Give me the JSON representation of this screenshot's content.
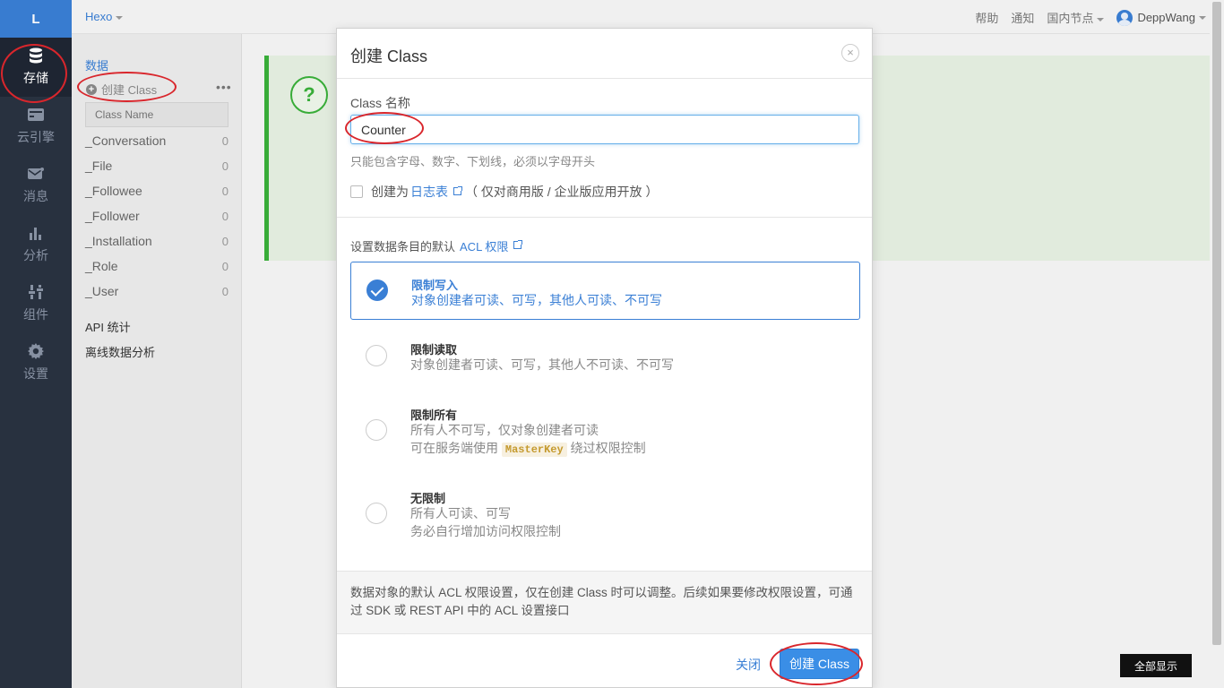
{
  "leftnav": {
    "logo": "L",
    "items": [
      {
        "label": "存储",
        "icon": "database-icon",
        "active": true
      },
      {
        "label": "云引擎",
        "icon": "server-icon"
      },
      {
        "label": "消息",
        "icon": "envelope-icon"
      },
      {
        "label": "分析",
        "icon": "bar-chart-icon"
      },
      {
        "label": "组件",
        "icon": "sliders-icon"
      },
      {
        "label": "设置",
        "icon": "gear-icon"
      }
    ]
  },
  "topbar": {
    "app_name": "Hexo",
    "help": "帮助",
    "notify": "通知",
    "region": "国内节点",
    "user": "DeppWang"
  },
  "sidebar": {
    "section": "数据",
    "create_class": "创建 Class",
    "more": "•••",
    "search_placeholder": "Class Name",
    "classes": [
      {
        "name": "_Conversation",
        "count": "0"
      },
      {
        "name": "_File",
        "count": "0"
      },
      {
        "name": "_Followee",
        "count": "0"
      },
      {
        "name": "_Follower",
        "count": "0"
      },
      {
        "name": "_Installation",
        "count": "0"
      },
      {
        "name": "_Role",
        "count": "0"
      },
      {
        "name": "_User",
        "count": "0"
      }
    ],
    "api_stats": "API 统计",
    "offline_analysis": "离线数据分析"
  },
  "main": {
    "help_symbol": "?"
  },
  "modal": {
    "title": "创建 Class",
    "close_symbol": "×",
    "name_label": "Class 名称",
    "name_value": "Counter",
    "hint": "只能包含字母、数字、下划线，必须以字母开头",
    "log_prefix": "创建为",
    "log_link": "日志表",
    "log_suffix": "（ 仅对商用版 / 企业版应用开放 ）",
    "acl_label_prefix": "设置数据条目的默认",
    "acl_link": "ACL 权限",
    "options": [
      {
        "title": "限制写入",
        "lines": [
          "对象创建者可读、可写，其他人可读、不可写"
        ],
        "selected": true
      },
      {
        "title": "限制读取",
        "lines": [
          "对象创建者可读、可写，其他人不可读、不可写"
        ],
        "selected": false
      },
      {
        "title": "限制所有",
        "lines": [
          "所有人不可写，仅对象创建者可读"
        ],
        "line2_prefix": "可在服务端使用",
        "line2_code": "MasterKey",
        "line2_suffix": "绕过权限控制",
        "selected": false
      },
      {
        "title": "无限制",
        "lines": [
          "所有人可读、可写",
          "务必自行增加访问权限控制"
        ],
        "selected": false
      }
    ],
    "note": "数据对象的默认 ACL 权限设置，仅在创建 Class 时可以调整。后续如果要修改权限设置，可通过 SDK 或 REST API 中的 ACL 设置接口",
    "close_button": "关闭",
    "create_button": "创建 Class"
  },
  "show_all": "全部显示"
}
